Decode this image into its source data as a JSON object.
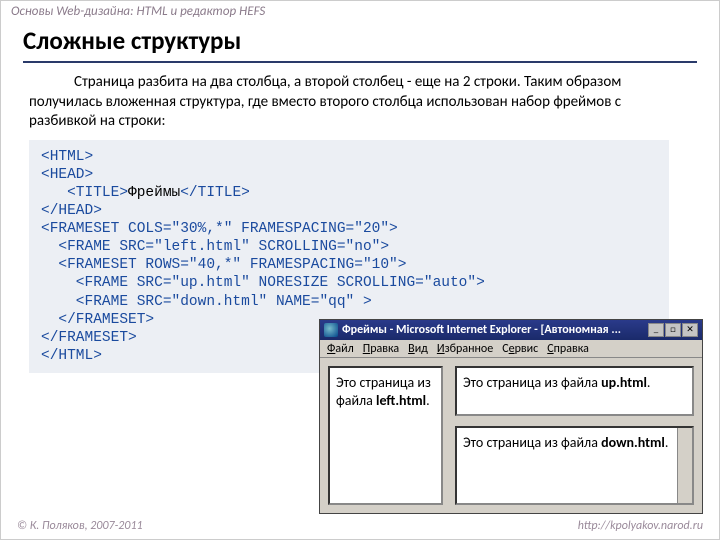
{
  "topbar": "Основы Web-дизайна: HTML и редактор HEFS",
  "title": "Сложные структуры",
  "paragraph": "Страница разбита на два столбца, а второй столбец - еще на 2 строки. Таким образом получилась вложенная структура, где вместо второго столбца использован набор фреймов с разбивкой на строки:",
  "code": {
    "l1": "<HTML>",
    "l2": "<HEAD>",
    "l3": "   <TITLE>",
    "l3t": "Фреймы",
    "l3c": "</TITLE>",
    "l4": "</HEAD>",
    "l5": "<FRAMESET COLS=\"30%,*\" FRAMESPACING=\"20\">",
    "l6": "  <FRAME SRC=\"left.html\" SCROLLING=\"no\">",
    "l7": "  <FRAMESET ROWS=\"40,*\" FRAMESPACING=\"10\">",
    "l8": "    <FRAME SRC=\"up.html\" NORESIZE SCROLLING=\"auto\">",
    "l9": "    <FRAME SRC=\"down.html\" NAME=\"qq\" >",
    "l10": "  </FRAMESET>",
    "l11": "</FRAMESET>",
    "l12": "</HTML>"
  },
  "browser": {
    "title": "Фреймы - Microsoft Internet Explorer - [Автономная ...",
    "menu": {
      "file": "Файл",
      "edit": "Правка",
      "view": "Вид",
      "fav": "Избранное",
      "tools": "Сервис",
      "help": "Справка"
    },
    "winbtns": {
      "min": "_",
      "max": "□",
      "close": "✕"
    },
    "left_text": "Это страница из файла ",
    "left_bold": "left.html",
    "up_text": "Это страница из файла ",
    "up_bold": "up.html",
    "down_text": "Это страница из файла ",
    "down_bold": "down.html",
    "dot": "."
  },
  "footer": {
    "left": "© К. Поляков, 2007-2011",
    "right": "http://kpolyakov.narod.ru"
  }
}
